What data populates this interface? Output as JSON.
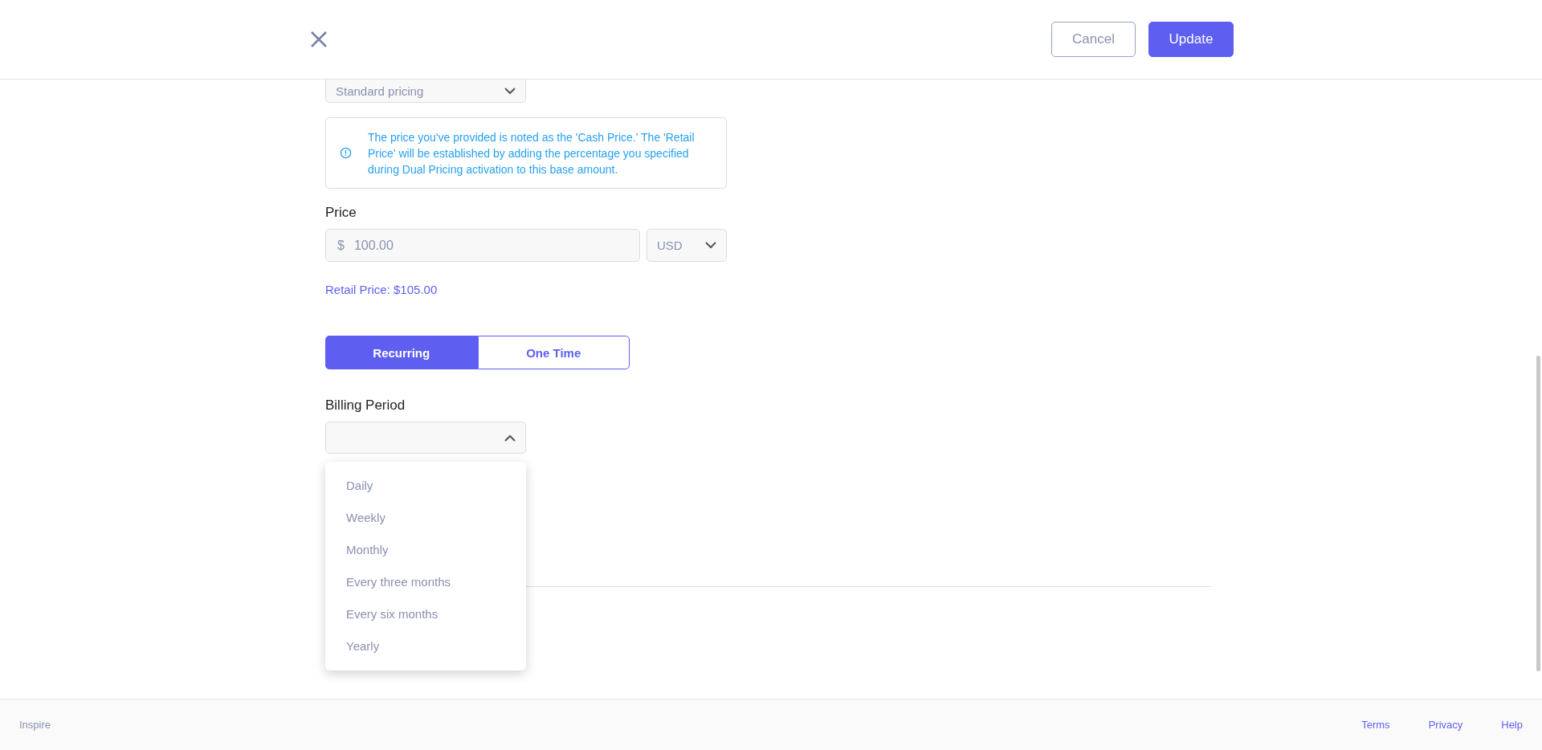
{
  "header": {
    "buttons": [
      {
        "label": "Cancel",
        "kind": "secondary"
      },
      {
        "label": "Update",
        "kind": "primary"
      }
    ]
  },
  "pricing_select": {
    "value": "Standard pricing"
  },
  "info": {
    "text": "The price you've provided is noted as the 'Cash Price.' The 'Retail Price' will be established by adding the percentage you specified during Dual Pricing activation to this base amount."
  },
  "price": {
    "label": "Price",
    "currency_symbol": "$",
    "value": "100.00",
    "currency": "USD"
  },
  "retail_price": "Retail Price: $105.00",
  "payment_type": [
    {
      "label": "Recurring",
      "selected": true
    },
    {
      "label": "One Time",
      "selected": false
    }
  ],
  "billing_period": {
    "label": "Billing Period",
    "expanded": true,
    "options": [
      {
        "label": "Daily"
      },
      {
        "label": "Weekly"
      },
      {
        "label": "Monthly"
      },
      {
        "label": "Every three months"
      },
      {
        "label": "Every six months"
      },
      {
        "label": "Yearly"
      }
    ]
  },
  "footer": {
    "brand": "Inspire",
    "links": [
      "Terms",
      "Privacy",
      "Help"
    ]
  }
}
